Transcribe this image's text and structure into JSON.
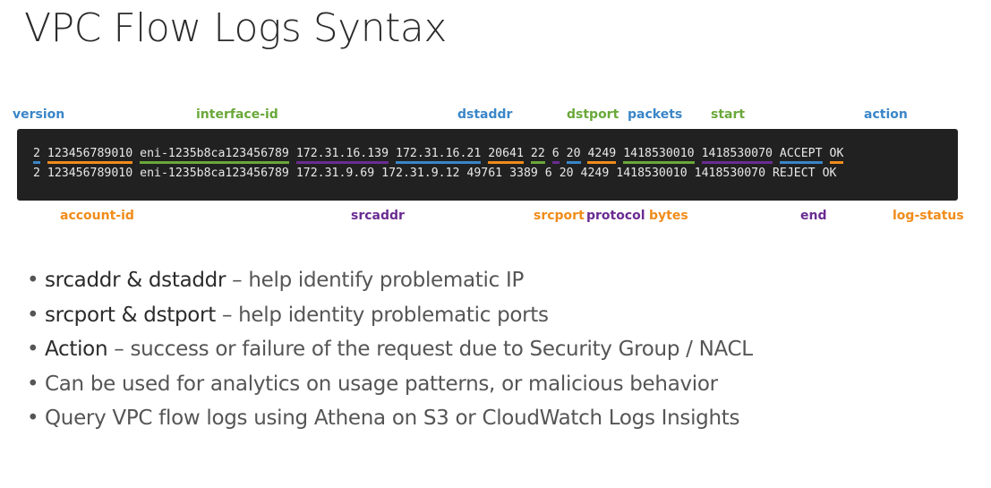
{
  "title": "VPC Flow Logs Syntax",
  "colors": {
    "blue": "#3a86c8",
    "green": "#6aa83a",
    "orange": "#f08c1a",
    "purple": "#6a2c91",
    "terminal_bg": "#212121",
    "terminal_text": "#e8e8e8"
  },
  "field_labels_top": [
    {
      "text": "version",
      "color": "blue"
    },
    {
      "text": "interface-id",
      "color": "green"
    },
    {
      "text": "dstaddr",
      "color": "blue"
    },
    {
      "text": "dstport",
      "color": "green"
    },
    {
      "text": "packets",
      "color": "blue"
    },
    {
      "text": "start",
      "color": "green"
    },
    {
      "text": "action",
      "color": "blue"
    }
  ],
  "field_labels_bottom": [
    {
      "text": "account-id",
      "color": "orange"
    },
    {
      "text": "srcaddr",
      "color": "purple"
    },
    {
      "text": "srcport",
      "color": "orange"
    },
    {
      "text": "protocol",
      "color": "purple"
    },
    {
      "text": "bytes",
      "color": "orange"
    },
    {
      "text": "end",
      "color": "purple"
    },
    {
      "text": "log-status",
      "color": "orange"
    }
  ],
  "log_lines": [
    {
      "fields": [
        {
          "text": "2",
          "underline": "blue"
        },
        {
          "text": "123456789010",
          "underline": "orange"
        },
        {
          "text": "eni-1235b8ca123456789",
          "underline": "green"
        },
        {
          "text": "172.31.16.139",
          "underline": "purple"
        },
        {
          "text": "172.31.16.21",
          "underline": "blue"
        },
        {
          "text": "20641",
          "underline": "orange"
        },
        {
          "text": "22",
          "underline": "green"
        },
        {
          "text": "6",
          "underline": "purple"
        },
        {
          "text": "20",
          "underline": "blue"
        },
        {
          "text": "4249",
          "underline": "orange"
        },
        {
          "text": "1418530010",
          "underline": "green"
        },
        {
          "text": "1418530070",
          "underline": "purple"
        },
        {
          "text": "ACCEPT",
          "underline": "blue"
        },
        {
          "text": "OK",
          "underline": "orange"
        }
      ]
    },
    {
      "fields": [
        {
          "text": "2",
          "underline": null
        },
        {
          "text": "123456789010",
          "underline": null
        },
        {
          "text": "eni-1235b8ca123456789",
          "underline": null
        },
        {
          "text": "172.31.9.69",
          "underline": null
        },
        {
          "text": "172.31.9.12",
          "underline": null
        },
        {
          "text": "49761",
          "underline": null
        },
        {
          "text": "3389",
          "underline": null
        },
        {
          "text": "6",
          "underline": null
        },
        {
          "text": "20",
          "underline": null
        },
        {
          "text": "4249",
          "underline": null
        },
        {
          "text": "1418530010",
          "underline": null
        },
        {
          "text": "1418530070",
          "underline": null
        },
        {
          "text": "REJECT",
          "underline": null
        },
        {
          "text": "OK",
          "underline": null
        }
      ]
    }
  ],
  "bullets": [
    {
      "term": "srcaddr & dstaddr",
      "rest": " – help identify problematic IP"
    },
    {
      "term": "srcport & dstport",
      "rest": " – help identity problematic ports"
    },
    {
      "term": "Action",
      "rest": " – success or failure of the request due to Security Group / NACL"
    },
    {
      "term": "",
      "rest": "Can be used for analytics on usage patterns, or malicious behavior"
    },
    {
      "term": "",
      "rest": "Query VPC flow logs using Athena on S3 or CloudWatch Logs Insights"
    }
  ]
}
